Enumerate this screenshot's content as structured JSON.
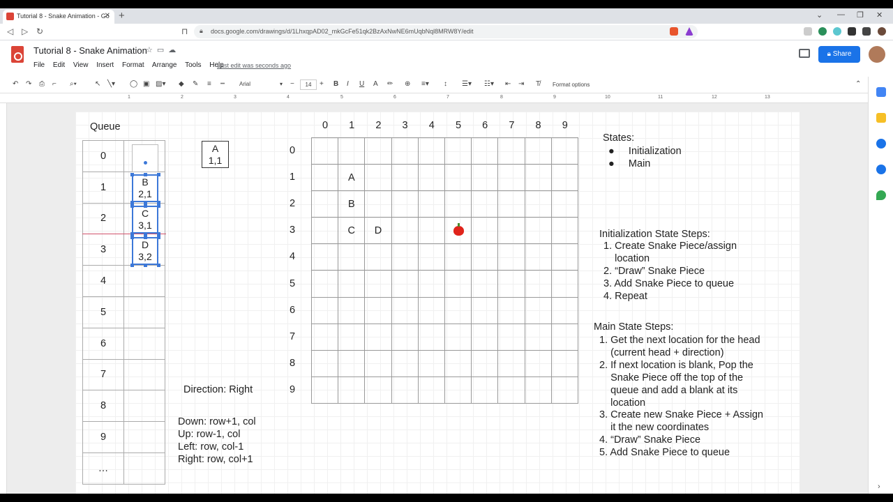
{
  "browser": {
    "tab_title": "Tutorial 8 - Snake Animation - Go",
    "url": "docs.google.com/drawings/d/1LhxqpAD02_mkGcFe51qk2BzAxNwNE6mUqbNql8MRW8Y/edit"
  },
  "app": {
    "doc_title": "Tutorial 8 - Snake Animation",
    "menu": [
      "File",
      "Edit",
      "View",
      "Insert",
      "Format",
      "Arrange",
      "Tools",
      "Help"
    ],
    "last_edit": "Last edit was seconds ago",
    "share_label": "Share"
  },
  "toolbar": {
    "font": "Arial",
    "font_size": "14",
    "bold": "B",
    "italic": "I",
    "underline": "U",
    "text_color": "A",
    "format_options": "Format options"
  },
  "ruler": [
    "1",
    "2",
    "3",
    "4",
    "5",
    "6",
    "7",
    "8",
    "9",
    "10",
    "11",
    "12",
    "13"
  ],
  "drawing": {
    "queue_title": "Queue",
    "queue_rows": [
      "0",
      "1",
      "2",
      "3",
      "4",
      "5",
      "6",
      "7",
      "8",
      "9",
      "…"
    ],
    "queue_pieces": [
      {
        "letter": "B",
        "coord": "2,1"
      },
      {
        "letter": "C",
        "coord": "3,1"
      },
      {
        "letter": "D",
        "coord": "3,2"
      }
    ],
    "piece_a": {
      "letter": "A",
      "coord": "1,1"
    },
    "direction": "Direction: Right",
    "moves": [
      "Down: row+1, col",
      "Up: row-1, col",
      "Left: row, col-1",
      "Right: row, col+1"
    ],
    "grid_cols": [
      "0",
      "1",
      "2",
      "3",
      "4",
      "5",
      "6",
      "7",
      "8",
      "9"
    ],
    "grid_rows": [
      "0",
      "1",
      "2",
      "3",
      "4",
      "5",
      "6",
      "7",
      "8",
      "9"
    ],
    "grid_cells": [
      {
        "row": 1,
        "col": 1,
        "text": "A"
      },
      {
        "row": 2,
        "col": 1,
        "text": "B"
      },
      {
        "row": 3,
        "col": 1,
        "text": "C"
      },
      {
        "row": 3,
        "col": 2,
        "text": "D"
      }
    ],
    "apple_cell": {
      "row": 3,
      "col": 5
    },
    "states_title": "States:",
    "states": [
      "Initialization",
      "Main"
    ],
    "init_title": "Initialization State Steps:",
    "init_steps": [
      "1. Create Snake Piece/assign",
      "    location",
      "2. “Draw” Snake Piece",
      "3. Add Snake Piece to queue",
      "4. Repeat"
    ],
    "main_title": "Main State Steps:",
    "main_steps": [
      "1. Get the next location for the head",
      "    (current head + direction)",
      "2. If next location is blank, Pop the",
      "    Snake Piece off the top of the",
      "    queue and add a blank at its",
      "    location",
      "3. Create new Snake Piece + Assign",
      "    it the new coordinates",
      "4. “Draw” Snake Piece",
      "5. Add Snake Piece to queue"
    ]
  }
}
